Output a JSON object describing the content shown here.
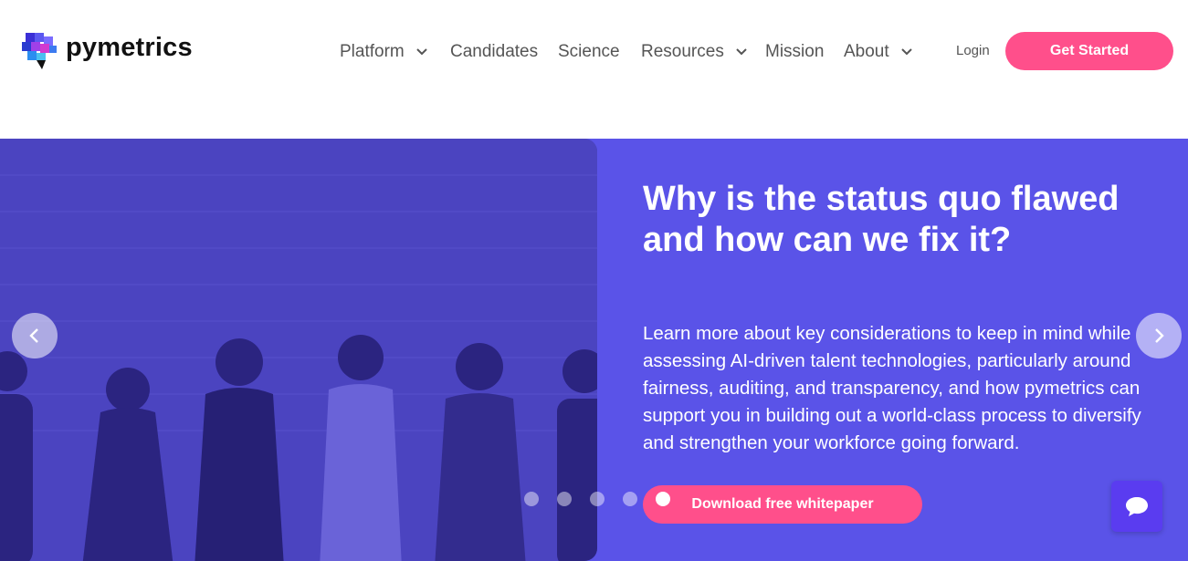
{
  "brand": {
    "name": "pymetrics",
    "logo_icon": "pymetrics-cube-logo-icon"
  },
  "nav": {
    "items": [
      {
        "label": "Platform",
        "has_dropdown": true
      },
      {
        "label": "Candidates",
        "has_dropdown": false
      },
      {
        "label": "Science",
        "has_dropdown": false
      },
      {
        "label": "Resources",
        "has_dropdown": true
      },
      {
        "label": "Mission",
        "has_dropdown": false
      },
      {
        "label": "About",
        "has_dropdown": true
      }
    ],
    "login_label": "Login",
    "cta_label": "Get Started"
  },
  "hero": {
    "title": "Why is the status quo flawed and how can we fix it?",
    "body": "Learn more about key considerations to keep in mind while assessing AI-driven talent technologies, particularly around fairness, auditing, and transparency, and how pymetrics can support you in building out a world-class process to diversify and strengthen your workforce going forward.",
    "button_label": "Download free whitepaper",
    "prev_icon": "chevron-left-icon",
    "next_icon": "chevron-right-icon",
    "slide_count": 5,
    "active_slide": 5
  },
  "chat": {
    "icon": "chat-bubble-icon"
  },
  "colors": {
    "accent_pink": "#ff4f8b",
    "hero_purple": "#5a53e8",
    "chat_purple": "#5a3cf0",
    "text_dark": "#111111",
    "nav_text": "#555555"
  }
}
